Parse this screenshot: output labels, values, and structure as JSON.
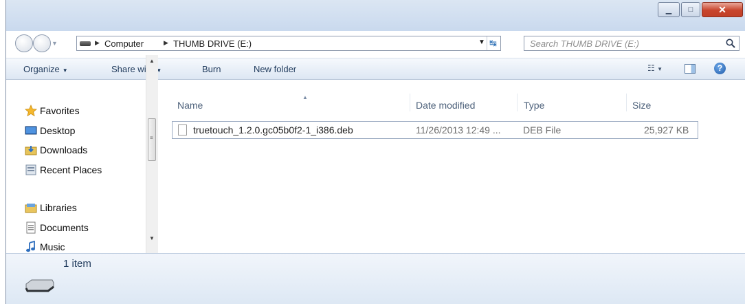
{
  "window": {
    "caption_buttons": {
      "minimize_icon": "minimize-icon",
      "maximize_icon": "maximize-icon",
      "close_icon": "close-icon"
    }
  },
  "address_bar": {
    "breadcrumb": [
      "Computer",
      "THUMB DRIVE (E:)"
    ]
  },
  "search": {
    "placeholder": "Search THUMB DRIVE (E:)"
  },
  "toolbar": {
    "organize": "Organize",
    "share_with": "Share with",
    "burn": "Burn",
    "new_folder": "New folder"
  },
  "nav_pane": {
    "items": [
      {
        "label": "Favorites",
        "icon": "star-icon"
      },
      {
        "label": "Desktop",
        "icon": "desktop-icon"
      },
      {
        "label": "Downloads",
        "icon": "downloads-folder-icon"
      },
      {
        "label": "Recent Places",
        "icon": "recent-places-icon"
      },
      {
        "label": "Libraries",
        "icon": "libraries-icon"
      },
      {
        "label": "Documents",
        "icon": "documents-icon"
      },
      {
        "label": "Music",
        "icon": "music-icon"
      }
    ]
  },
  "file_list": {
    "columns": [
      "Name",
      "Date modified",
      "Type",
      "Size"
    ],
    "rows": [
      {
        "name": "truetouch_1.2.0.gc05b0f2-1_i386.deb",
        "date": "11/26/2013 12:49 ...",
        "type": "DEB File",
        "size": "25,927 KB"
      }
    ]
  },
  "details": {
    "count": "1 item"
  },
  "colors": {
    "accent": "#1e395b",
    "close_button": "#c8452d",
    "selection_border": "#99a9c0"
  }
}
